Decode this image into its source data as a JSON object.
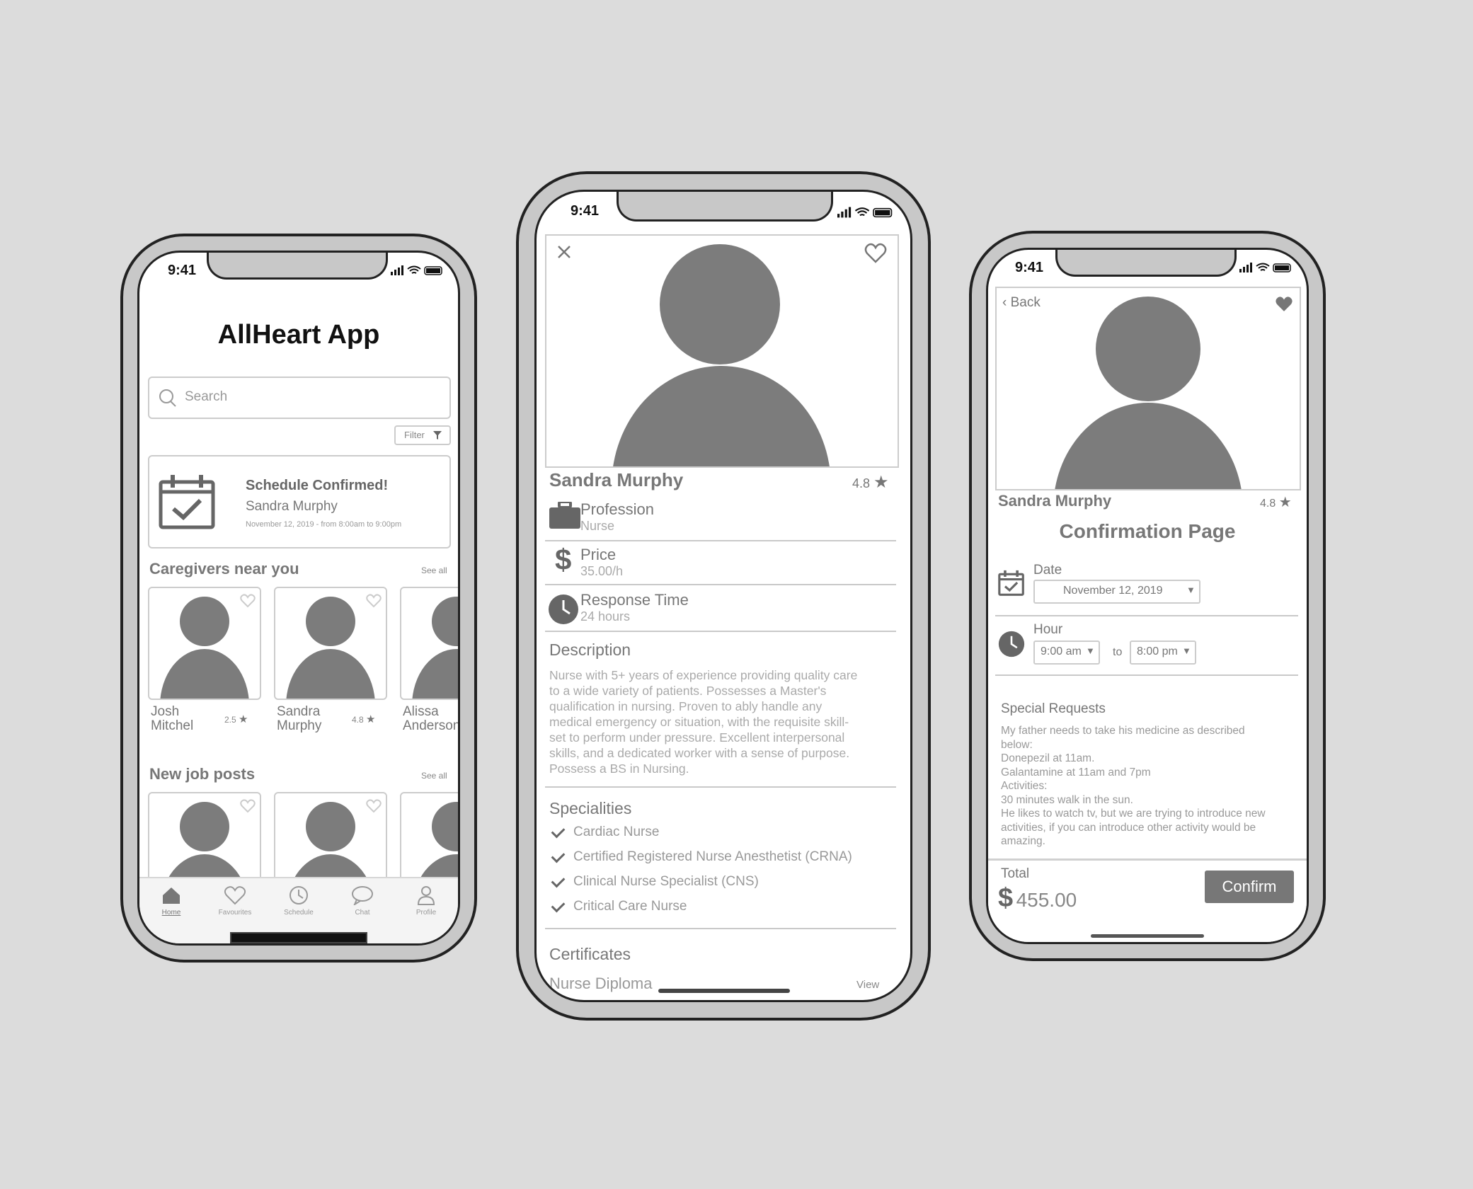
{
  "status_bar": {
    "time": "9:41"
  },
  "phone1": {
    "app_title": "AllHeart App",
    "search": {
      "placeholder": "Search"
    },
    "filter_label": "Filter",
    "notification": {
      "title": "Schedule Confirmed!",
      "name": "Sandra Murphy",
      "details": "November 12, 2019 - from 8:00am to 9:00pm"
    },
    "caregivers_section": {
      "title": "Caregivers near you",
      "see_all": "See all"
    },
    "caregivers": [
      {
        "first": "Josh",
        "last": "Mitchel",
        "rating": "2.5"
      },
      {
        "first": "Sandra",
        "last": "Murphy",
        "rating": "4.8"
      },
      {
        "first": "Alissa",
        "last": "Anderson",
        "rating": ""
      }
    ],
    "jobs_section": {
      "title": "New job posts",
      "see_all": "See all"
    },
    "tabs": [
      {
        "label": "Home",
        "icon": "home-icon"
      },
      {
        "label": "Favourites",
        "icon": "heart-icon"
      },
      {
        "label": "Schedule",
        "icon": "clock-icon"
      },
      {
        "label": "Chat",
        "icon": "chat-icon"
      },
      {
        "label": "Profile",
        "icon": "profile-icon"
      }
    ]
  },
  "phone2": {
    "name": "Sandra Murphy",
    "rating": "4.8",
    "profession": {
      "label": "Profession",
      "value": "Nurse"
    },
    "price": {
      "label": "Price",
      "value": "35.00/h"
    },
    "response": {
      "label": "Response Time",
      "value": "24 hours"
    },
    "description": {
      "title": "Description",
      "lines": [
        "Nurse with 5+ years of experience providing quality care",
        "to a wide variety of patients. Possesses a Master's",
        "qualification in nursing. Proven to ably handle any",
        "medical emergency or situation, with the requisite skill-",
        "set to perform under pressure. Excellent interpersonal",
        "skills, and a dedicated worker with a sense of purpose.",
        "Possess a BS in Nursing."
      ]
    },
    "specialities": {
      "title": "Specialities",
      "items": [
        "Cardiac Nurse",
        "Certified Registered Nurse Anesthetist (CRNA)",
        "Clinical Nurse Specialist (CNS)",
        "Critical Care Nurse"
      ]
    },
    "certificates": {
      "title": "Certificates",
      "item": "Nurse Diploma",
      "view": "View"
    }
  },
  "phone3": {
    "back": "Back",
    "name": "Sandra Murphy",
    "rating": "4.8",
    "page_title": "Confirmation Page",
    "date": {
      "label": "Date",
      "value": "November 12, 2019"
    },
    "hour": {
      "label": "Hour",
      "from": "9:00 am",
      "to_label": "to",
      "to": "8:00 pm"
    },
    "requests": {
      "title": "Special Requests",
      "lines": [
        "My father needs to take his medicine as described",
        "below:",
        "Donepezil at 11am.",
        "Galantamine at 11am and 7pm",
        "Activities:",
        "30 minutes walk in the sun.",
        "He likes to watch tv, but we are trying to introduce new",
        "activities, if you can introduce other activity would be",
        "amazing."
      ]
    },
    "total": {
      "label": "Total",
      "currency": "$",
      "amount": "455.00"
    },
    "confirm": "Confirm"
  }
}
